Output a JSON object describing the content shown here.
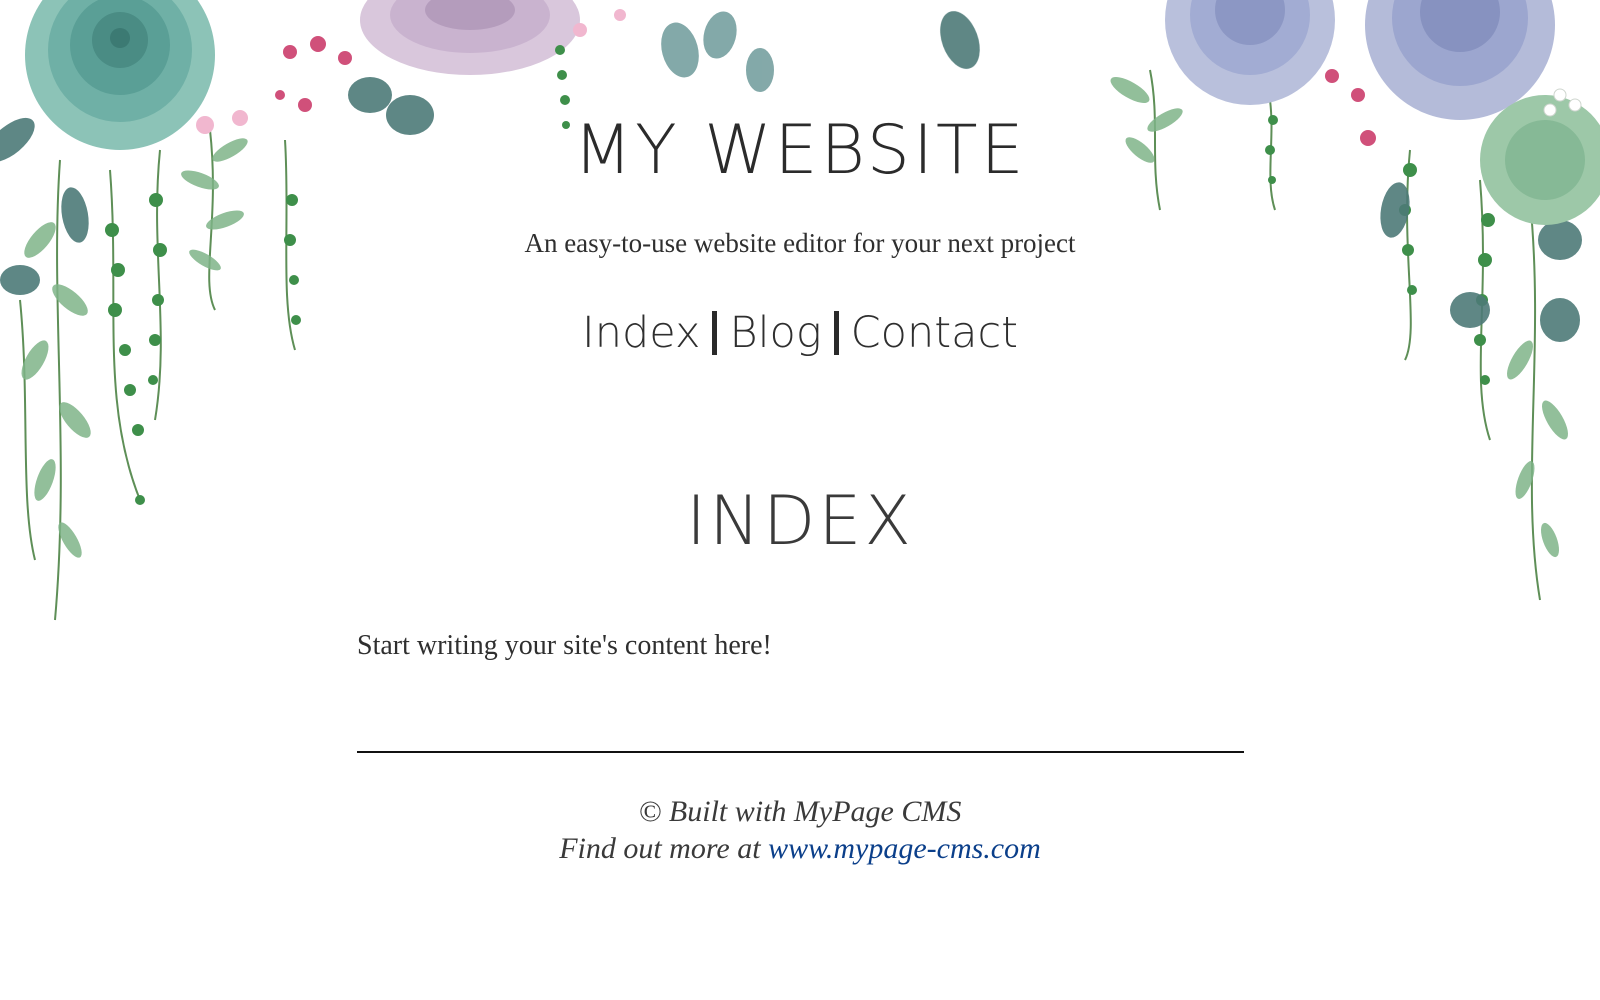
{
  "site": {
    "title": "MY WEBSITE",
    "tagline": "An easy-to-use website editor for your next project"
  },
  "nav": {
    "items": [
      {
        "label": "Index"
      },
      {
        "label": "Blog"
      },
      {
        "label": "Contact"
      }
    ]
  },
  "main": {
    "heading": "INDEX",
    "body": "Start writing your site's content here!"
  },
  "footer": {
    "built_with": "© Built with MyPage CMS",
    "find_more_prefix": "Find out more at ",
    "link_text": "www.mypage-cms.com"
  },
  "colors": {
    "text": "#2f2f2f",
    "link": "#0b3f8a",
    "leaf_dark": "#3f6f6a",
    "leaf_green": "#4f9a4a",
    "succulent_teal": "#6fb0a6",
    "succulent_lavender": "#9aa6cf",
    "flower_pink": "#d0507a"
  }
}
